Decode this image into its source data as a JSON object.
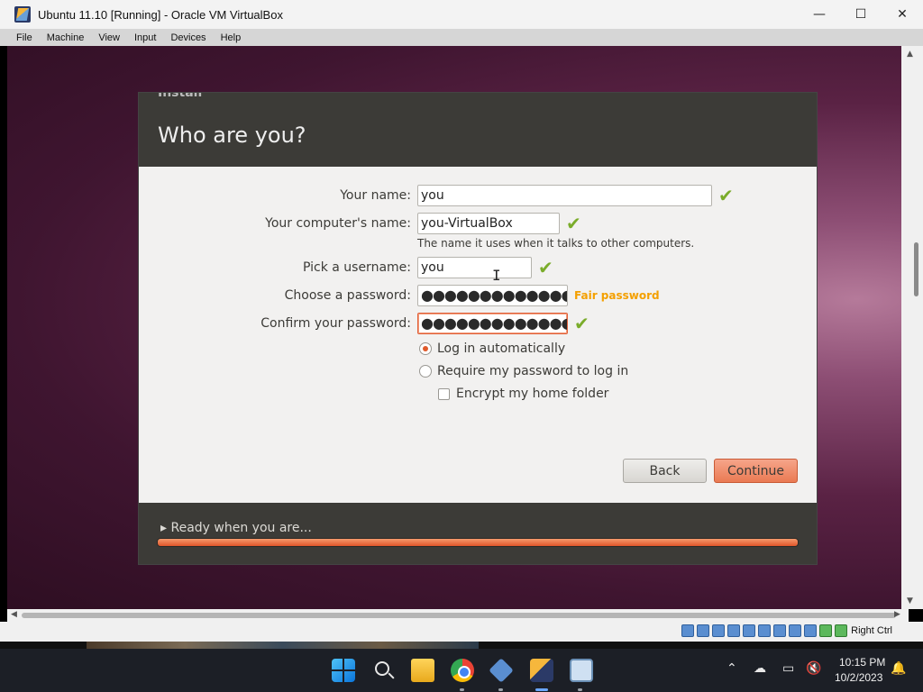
{
  "window": {
    "title": "Ubuntu 11.10 [Running] - Oracle VM VirtualBox",
    "minimize_icon": "minimize-icon",
    "maximize_icon": "maximize-icon",
    "close_icon": "close-icon"
  },
  "menubar": {
    "items": [
      "File",
      "Machine",
      "View",
      "Input",
      "Devices",
      "Help"
    ]
  },
  "installer": {
    "breadcrumb": "Install",
    "title": "Who are you?",
    "fields": {
      "your_name": {
        "label": "Your name:",
        "value": "you",
        "valid": true
      },
      "computer_name": {
        "label": "Your computer's name:",
        "value": "you-VirtualBox",
        "valid": true,
        "hint": "The name it uses when it talks to other computers."
      },
      "username": {
        "label": "Pick a username:",
        "value": "you",
        "valid": true
      },
      "password": {
        "label": "Choose a password:",
        "value": "●●●●●●●●●●●●●",
        "strength": "Fair password"
      },
      "confirm_password": {
        "label": "Confirm your password:",
        "value": "●●●●●●●●●●●●●",
        "valid": true
      }
    },
    "login_options": {
      "auto_login": {
        "label": "Log in automatically",
        "selected": true
      },
      "require_password": {
        "label": "Require my password to log in",
        "selected": false
      },
      "encrypt_home": {
        "label": "Encrypt my home folder",
        "checked": false
      }
    },
    "buttons": {
      "back": "Back",
      "continue": "Continue"
    },
    "footer": {
      "status": "Ready when you are...",
      "progress": 1.0
    },
    "check_icon": "✔"
  },
  "statusbar": {
    "host_key": "Right Ctrl"
  },
  "taskbar": {
    "apps": [
      "start-icon",
      "search-icon",
      "file-explorer-icon",
      "chrome-icon",
      "virtualbox-icon",
      "vm-window-icon",
      "monitor-icon"
    ],
    "tray_icons": [
      "chevron-up-icon",
      "cloud-icon",
      "display-icon",
      "volume-muted-icon",
      "notification-bell-icon"
    ],
    "time": "10:15 PM",
    "date": "10/2/2023"
  },
  "colors": {
    "ubuntu_orange": "#e05a2b",
    "installer_dark": "#3c3b37",
    "valid_green": "#7aac2a",
    "fair_password": "#f4a000"
  }
}
